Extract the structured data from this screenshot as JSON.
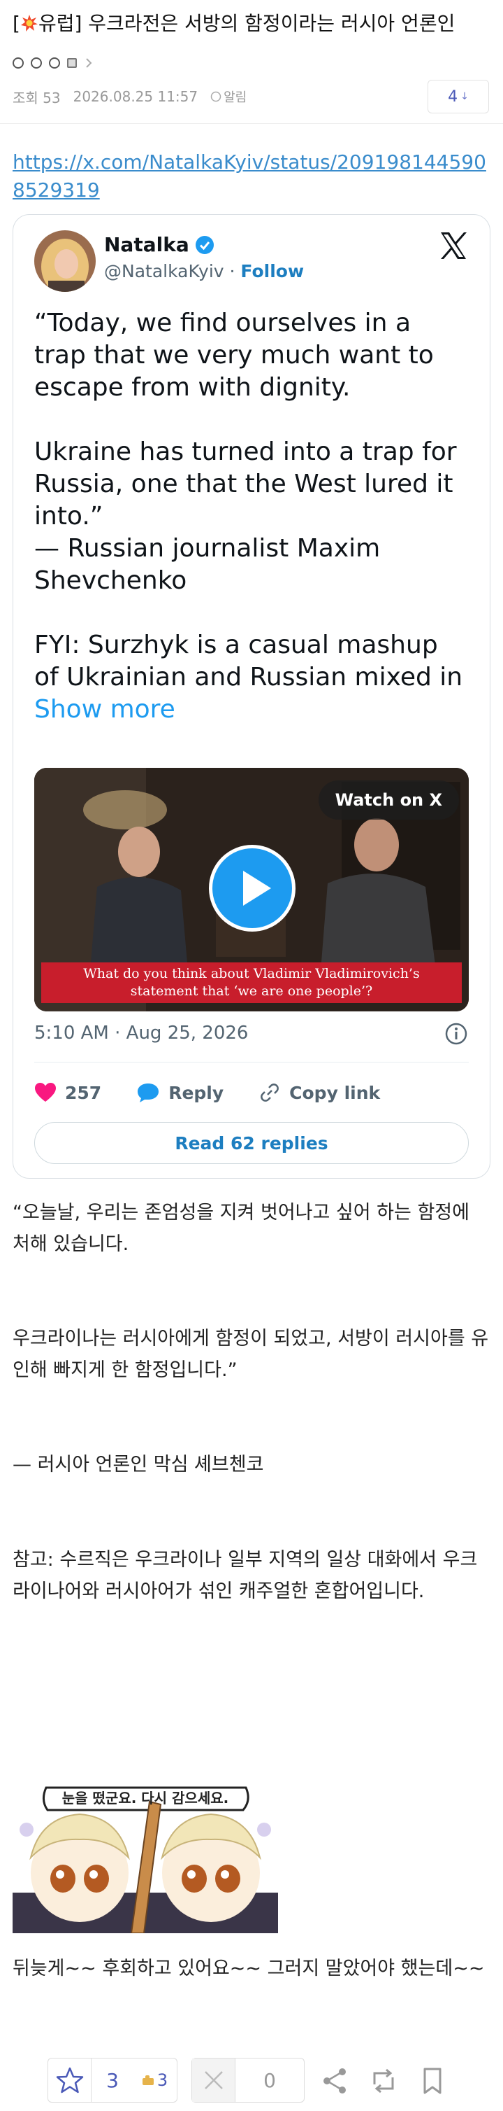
{
  "post": {
    "title_prefix": "[",
    "title_category": "유럽]",
    "title_text": " 우크라전은 서방의 함정이라는 러시아 언론인",
    "views": "조회 53",
    "date": "2026.08.25 11:57",
    "alarm_label": "알림",
    "comment_count": "4",
    "link": "https://x.com/NatalkaKyiv/status/2091981445908529319"
  },
  "tweet": {
    "name": "Natalka",
    "handle": "@NatalkaKyiv",
    "separator": " · ",
    "follow": "Follow",
    "paragraphs": [
      "“Today, we find ourselves in a trap that we very much want to escape from with dignity.",
      "Ukraine has turned into a trap for Russia, one that the West lured it into.”",
      "— Russian journalist Maxim Shevchenko"
    ],
    "fyi_text": "FYI: Surzhyk is a casual mashup of Ukrainian and Russian mixed in ",
    "show_more": "Show more",
    "video": {
      "watch_label": "Watch on X",
      "subtitle_line1": "What do you think about Vladimir Vladimirovich’s",
      "subtitle_line2": "statement that ‘we are one people’?"
    },
    "timestamp": "5:10 AM · Aug 25, 2026",
    "likes": "257",
    "reply_label": "Reply",
    "copy_label": "Copy link",
    "read_replies": "Read 62 replies"
  },
  "body": {
    "para1": "“오늘날, 우리는 존엄성을 지켜 벗어나고 싶어 하는 함정에 처해 있습니다.",
    "para2": "우크라이나는 러시아에게 함정이 되었고, 서방이 러시아를 유인해 빠지게 한 함정입니다.”",
    "para3": "— 러시아 언론인 막심 셰브첸코",
    "para4": "참고: 수르직은 우크라이나 일부 지역의 일상 대화에서 우크라이나어와 러시아어가 섞인 캐주얼한 혼합어입니다.",
    "sticker_text": "눈을 떴군요. 다시 감으세요.",
    "para5": "뒤늦게~~ 후회하고 있어요~~ 그러지 말았어야 했는데~~"
  },
  "votes": {
    "up": "3",
    "up_badge": "3",
    "down": "0"
  },
  "colors": {
    "accent": "#4a59b7",
    "link": "#3a8ccc",
    "twitter_blue": "#1d9bf0",
    "like_pink": "#f91880"
  }
}
